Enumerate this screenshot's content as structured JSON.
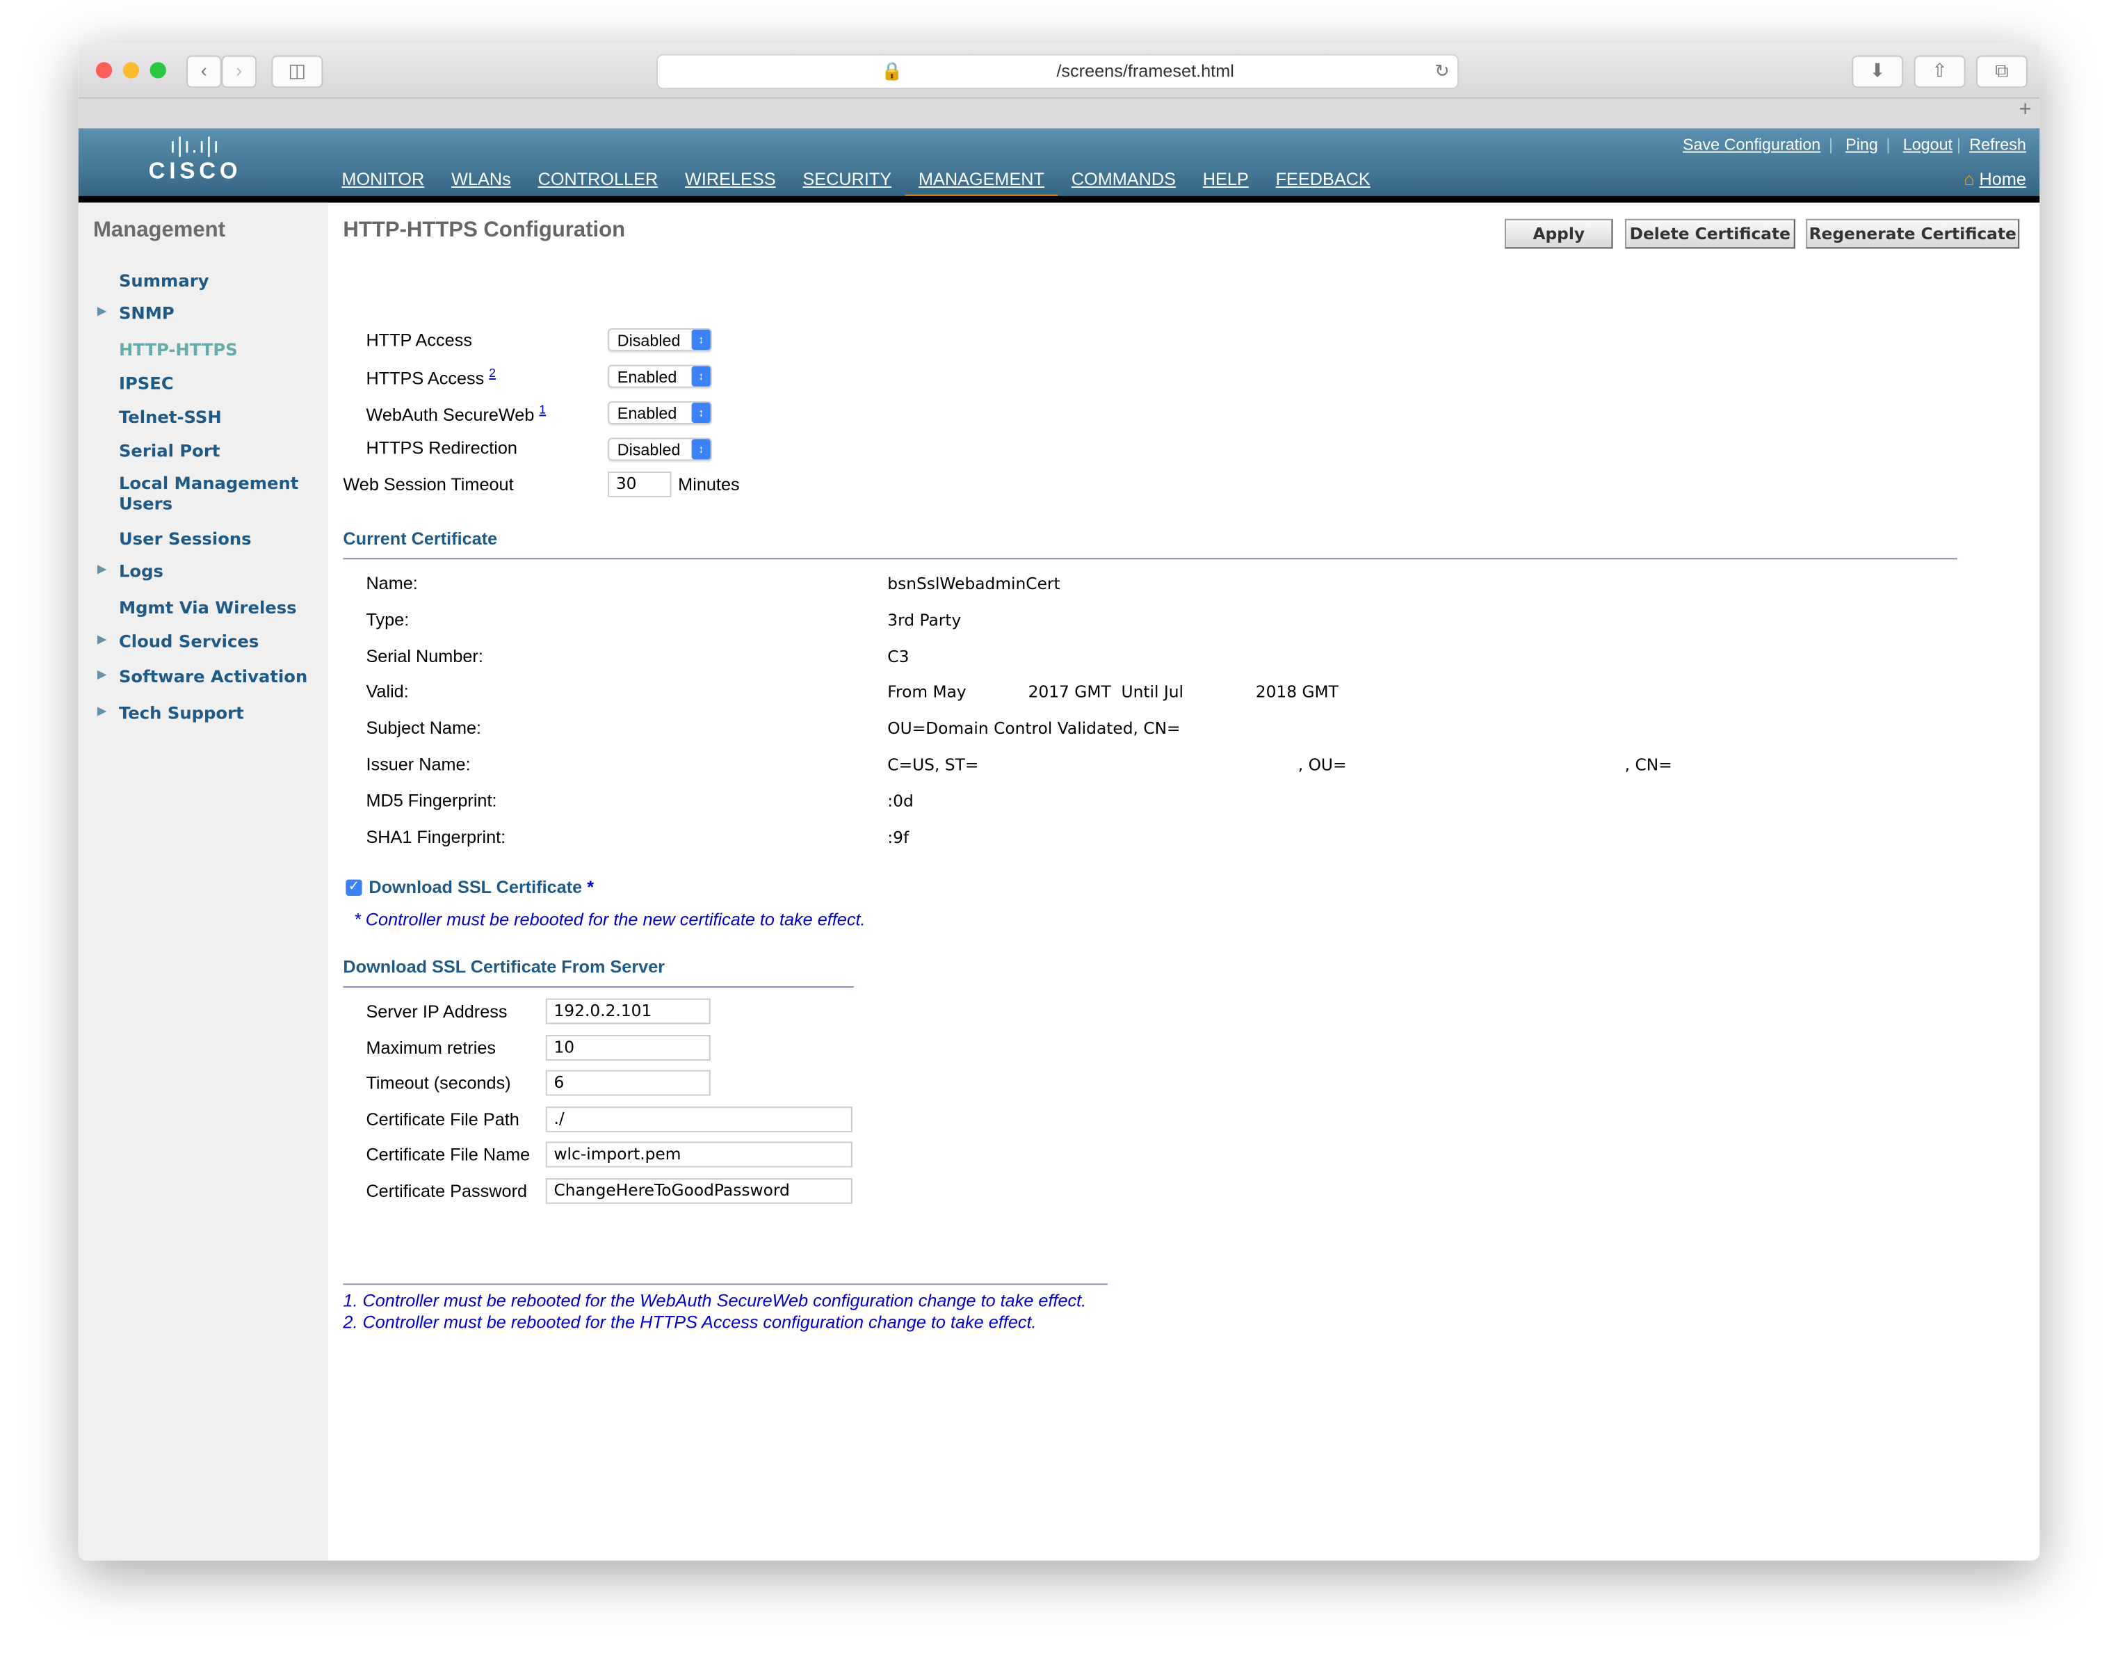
{
  "browser": {
    "url": "/screens/frameset.html",
    "icons": [
      "back-icon",
      "forward-icon",
      "sidebar-icon",
      "lock-icon",
      "reload-icon",
      "download-icon",
      "share-icon",
      "tabs-icon",
      "new-tab-icon"
    ]
  },
  "header": {
    "logo": "CISCO",
    "links": [
      "Save Configuration",
      "Ping",
      "Logout",
      "Refresh"
    ],
    "home": "Home",
    "nav": [
      "MONITOR",
      "WLANs",
      "CONTROLLER",
      "WIRELESS",
      "SECURITY",
      "MANAGEMENT",
      "COMMANDS",
      "HELP",
      "FEEDBACK"
    ],
    "active": "MANAGEMENT",
    "accent": "#f7931e"
  },
  "sidebar": {
    "title": "Management",
    "items": [
      {
        "label": "Summary",
        "expandable": false
      },
      {
        "label": "SNMP",
        "expandable": true
      },
      {
        "label": "HTTP-HTTPS",
        "expandable": false,
        "current": true
      },
      {
        "label": "IPSEC",
        "expandable": false
      },
      {
        "label": "Telnet-SSH",
        "expandable": false
      },
      {
        "label": "Serial Port",
        "expandable": false
      },
      {
        "label": "Local Management Users",
        "expandable": false
      },
      {
        "label": "User Sessions",
        "expandable": false
      },
      {
        "label": "Logs",
        "expandable": true
      },
      {
        "label": "Mgmt Via Wireless",
        "expandable": false
      },
      {
        "label": "Cloud Services",
        "expandable": true
      },
      {
        "label": "Software Activation",
        "expandable": true
      },
      {
        "label": "Tech Support",
        "expandable": true
      }
    ]
  },
  "main": {
    "title": "HTTP-HTTPS Configuration",
    "buttons": {
      "apply": "Apply",
      "delete": "Delete Certificate",
      "regenerate": "Regenerate Certificate"
    },
    "settings": [
      {
        "label": "HTTP Access",
        "value": "Disabled",
        "sup": ""
      },
      {
        "label": "HTTPS Access",
        "value": "Enabled",
        "sup": "2"
      },
      {
        "label": "WebAuth SecureWeb",
        "value": "Enabled",
        "sup": "1"
      },
      {
        "label": "HTTPS Redirection",
        "value": "Disabled",
        "sup": ""
      }
    ],
    "timeout": {
      "label": "Web Session Timeout",
      "value": "30",
      "unit": "Minutes"
    },
    "cert": {
      "heading": "Current Certificate",
      "rows": [
        {
          "label": "Name:",
          "value": "bsnSslWebadminCert"
        },
        {
          "label": "Type:",
          "value": "3rd Party"
        },
        {
          "label": "Serial Number:",
          "value": "C3"
        },
        {
          "label": "Valid:",
          "value": "From May            2017 GMT  Until Jul              2018 GMT"
        },
        {
          "label": "Subject Name:",
          "value": "OU=Domain Control Validated, CN="
        },
        {
          "label": "Issuer Name:",
          "value": "C=US, ST=                                                              , OU=                                                      , CN="
        },
        {
          "label": "MD5 Fingerprint:",
          "value": ":0d"
        },
        {
          "label": "SHA1 Fingerprint:",
          "value": ":9f"
        }
      ]
    },
    "download": {
      "checkbox_label": "Download SSL Certificate",
      "checked": true,
      "asterisk": "*",
      "note": "* Controller must be rebooted for the new certificate to take effect."
    },
    "server": {
      "heading": "Download SSL Certificate From Server",
      "fields": [
        {
          "label": "Server IP Address",
          "value": "192.0.2.101"
        },
        {
          "label": "Maximum retries",
          "value": "10"
        },
        {
          "label": "Timeout (seconds)",
          "value": "6"
        },
        {
          "label": "Certificate File Path",
          "value": "./"
        },
        {
          "label": "Certificate File Name",
          "value": "wlc-import.pem"
        },
        {
          "label": "Certificate Password",
          "value": "ChangeHereToGoodPassword"
        }
      ]
    },
    "footnotes": [
      "1. Controller must be rebooted for the WebAuth SecureWeb configuration change to take effect.",
      "2. Controller must be rebooted for the HTTPS Access configuration change to take effect."
    ]
  }
}
